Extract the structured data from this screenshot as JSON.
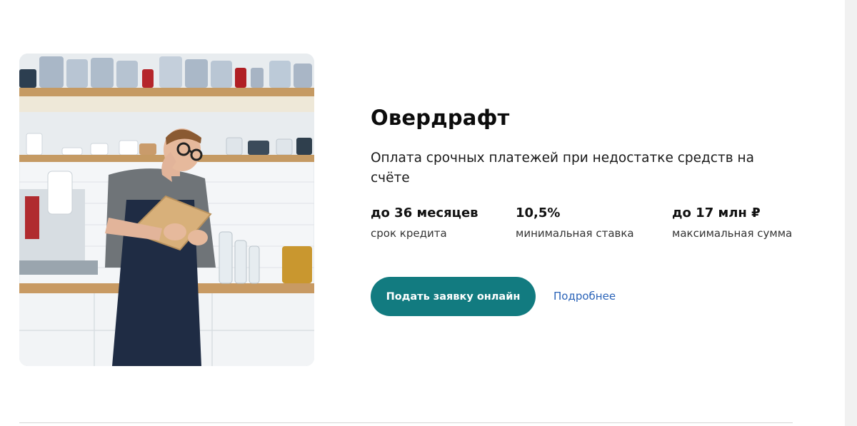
{
  "product": {
    "title": "Овердрафт",
    "subtitle": "Оплата срочных платежей при недостатке средств на счёте",
    "stats": [
      {
        "value": "до 36 месяцев",
        "label": "срок кредита"
      },
      {
        "value": "10,5%",
        "label": "минимальная ставка"
      },
      {
        "value": "до 17 млн ₽",
        "label": "максимальная сумма"
      }
    ],
    "apply_label": "Подать заявку онлайн",
    "more_label": "Подробнее"
  },
  "colors": {
    "accent": "#127b80",
    "link": "#2a63b8"
  },
  "image": {
    "subject": "barista-with-clipboard-photo"
  }
}
